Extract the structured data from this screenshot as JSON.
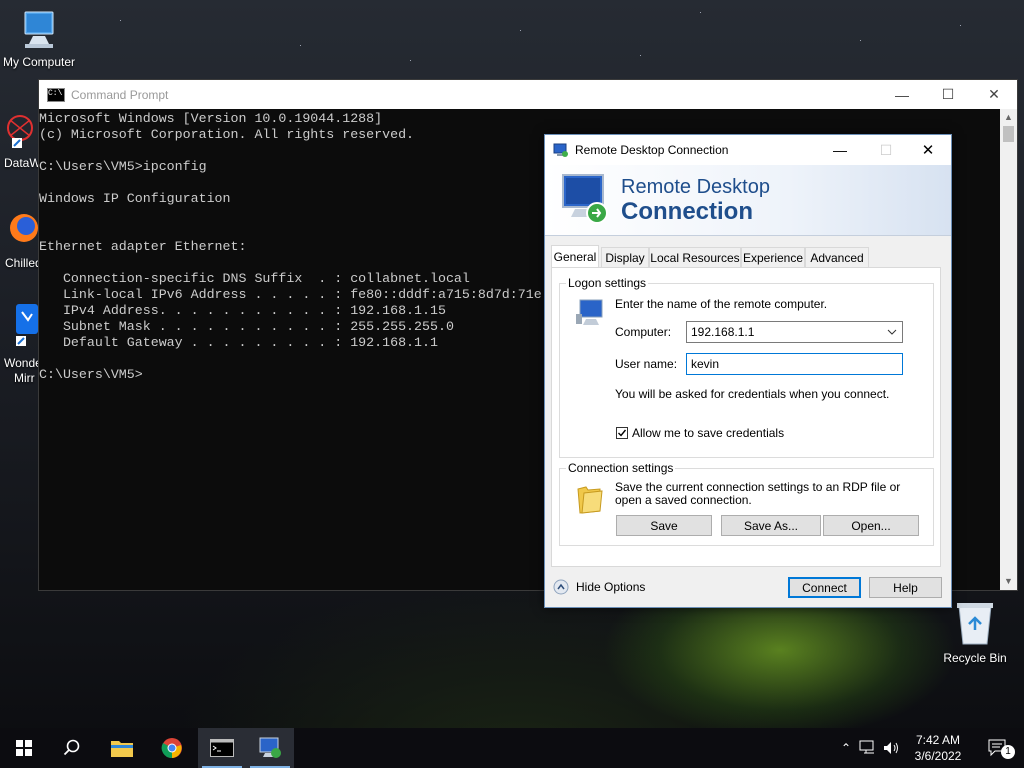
{
  "desktop": {
    "icons": {
      "my_computer": "My Computer",
      "datawrapper": "DataW",
      "chilled": "Chilled",
      "wonder": "Wonde",
      "wonder_line2": "Mirr",
      "recycle_bin": "Recycle Bin"
    }
  },
  "cmd": {
    "title": "Command Prompt",
    "lines": [
      "Microsoft Windows [Version 10.0.19044.1288]",
      "(c) Microsoft Corporation. All rights reserved.",
      "",
      "C:\\Users\\VM5>ipconfig",
      "",
      "Windows IP Configuration",
      "",
      "",
      "Ethernet adapter Ethernet:",
      "",
      "   Connection-specific DNS Suffix  . : collabnet.local",
      "   Link-local IPv6 Address . . . . . : fe80::dddf:a715:8d7d:71e",
      "   IPv4 Address. . . . . . . . . . . : 192.168.1.15",
      "   Subnet Mask . . . . . . . . . . . : 255.255.255.0",
      "   Default Gateway . . . . . . . . . : 192.168.1.1",
      "",
      "C:\\Users\\VM5>"
    ]
  },
  "rdp": {
    "title": "Remote Desktop Connection",
    "banner_line1": "Remote Desktop",
    "banner_line2": "Connection",
    "tabs": [
      "General",
      "Display",
      "Local Resources",
      "Experience",
      "Advanced"
    ],
    "logon": {
      "group_label": "Logon settings",
      "instruction": "Enter the name of the remote computer.",
      "computer_label": "Computer:",
      "computer_value": "192.168.1.1",
      "username_label": "User name:",
      "username_value": "kevin",
      "credentials_note": "You will be asked for credentials when you connect.",
      "allow_save_label": "Allow me to save credentials",
      "allow_save_checked": true
    },
    "connection": {
      "group_label": "Connection settings",
      "description": "Save the current connection settings to an RDP file or open a saved connection.",
      "save": "Save",
      "save_as": "Save As...",
      "open": "Open..."
    },
    "hide_options": "Hide Options",
    "connect": "Connect",
    "help": "Help"
  },
  "taskbar": {
    "time": "7:42 AM",
    "date": "3/6/2022",
    "notification_count": "1"
  },
  "colors": {
    "accent": "#0078d7",
    "banner_text": "#1f4e8c",
    "console_bg": "#0c0c0c",
    "console_text": "#cccccc"
  }
}
